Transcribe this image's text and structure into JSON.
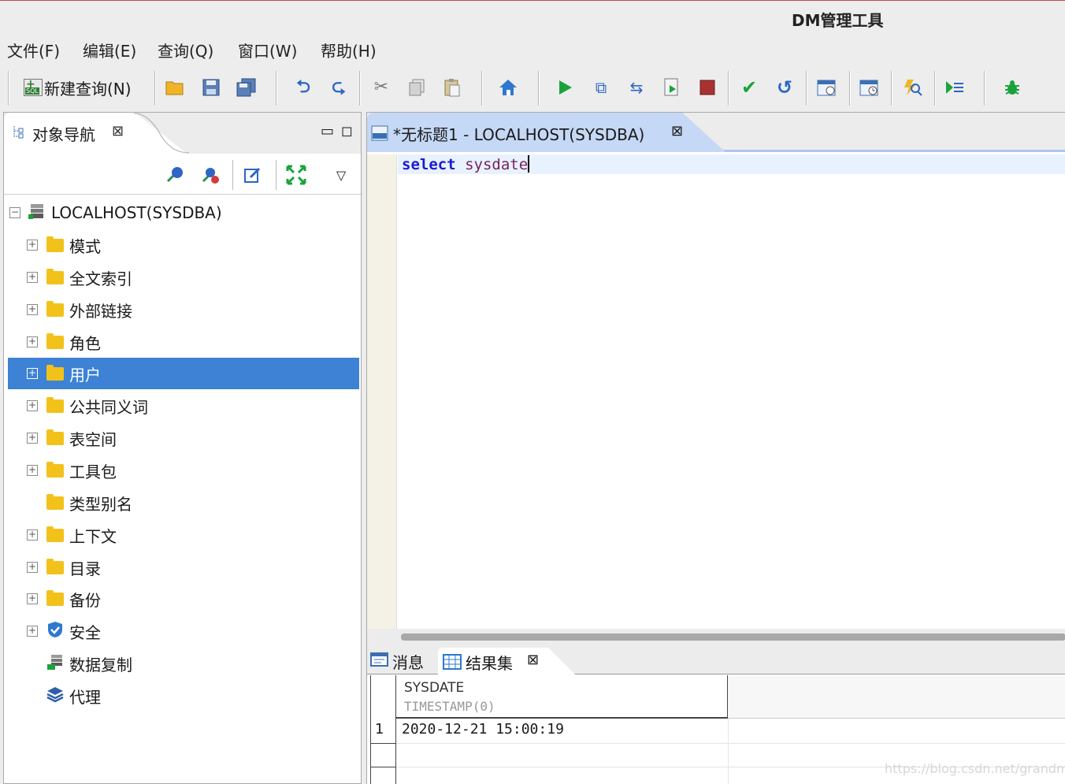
{
  "window": {
    "title": "DM管理工具"
  },
  "menu": [
    "文件(F)",
    "编辑(E)",
    "查询(Q)",
    "窗口(W)",
    "帮助(H)"
  ],
  "toolbar": {
    "new_query_label": "新建查询(N)",
    "sql_tag": "SQL",
    "icons": [
      "open-folder-icon",
      "save-icon",
      "save-all-icon",
      "undo-icon",
      "redo-icon",
      "cut-icon",
      "copy-icon",
      "paste-icon",
      "home-icon",
      "run-icon",
      "run-selected-icon",
      "explain-icon",
      "run-script-icon",
      "stop-icon",
      "commit-icon",
      "rollback-icon",
      "schedule-icon",
      "schedule-edit-icon",
      "search-object-icon",
      "debug-step-icon",
      "bug-icon"
    ]
  },
  "object_nav": {
    "tab_label": "对象导航",
    "close_glyph": "⊠",
    "min_glyph": "▭",
    "max_glyph": "◻",
    "dropdown_glyph": "▽",
    "root": "LOCALHOST(SYSDBA)",
    "items": [
      {
        "label": "模式",
        "expandable": true,
        "icon": "folder"
      },
      {
        "label": "全文索引",
        "expandable": true,
        "icon": "folder"
      },
      {
        "label": "外部链接",
        "expandable": true,
        "icon": "folder"
      },
      {
        "label": "角色",
        "expandable": true,
        "icon": "folder"
      },
      {
        "label": "用户",
        "expandable": true,
        "icon": "folder",
        "selected": true
      },
      {
        "label": "公共同义词",
        "expandable": true,
        "icon": "folder"
      },
      {
        "label": "表空间",
        "expandable": true,
        "icon": "folder"
      },
      {
        "label": "工具包",
        "expandable": true,
        "icon": "folder"
      },
      {
        "label": "类型别名",
        "expandable": false,
        "icon": "folder"
      },
      {
        "label": "上下文",
        "expandable": true,
        "icon": "folder"
      },
      {
        "label": "目录",
        "expandable": true,
        "icon": "folder"
      },
      {
        "label": "备份",
        "expandable": true,
        "icon": "folder"
      },
      {
        "label": "安全",
        "expandable": true,
        "icon": "shield"
      },
      {
        "label": "数据复制",
        "expandable": false,
        "icon": "replication"
      },
      {
        "label": "代理",
        "expandable": false,
        "icon": "layers"
      }
    ],
    "colors": {
      "selection": "#3d82d4",
      "folder": "#f2c21a"
    }
  },
  "editor": {
    "tab_label": "*无标题1 - LOCALHOST(SYSDBA)",
    "close_glyph": "⊠",
    "code_keyword": "select",
    "code_rest": "sysdate"
  },
  "results": {
    "tab_messages": "消息",
    "tab_resultset": "结果集",
    "close_glyph": "⊠",
    "column": {
      "name": "SYSDATE",
      "type": "TIMESTAMP(0)"
    },
    "rows": [
      {
        "num": "1",
        "value": "2020-12-21 15:00:19"
      }
    ]
  },
  "watermark": "https://blog.csdn.net/grandmath"
}
